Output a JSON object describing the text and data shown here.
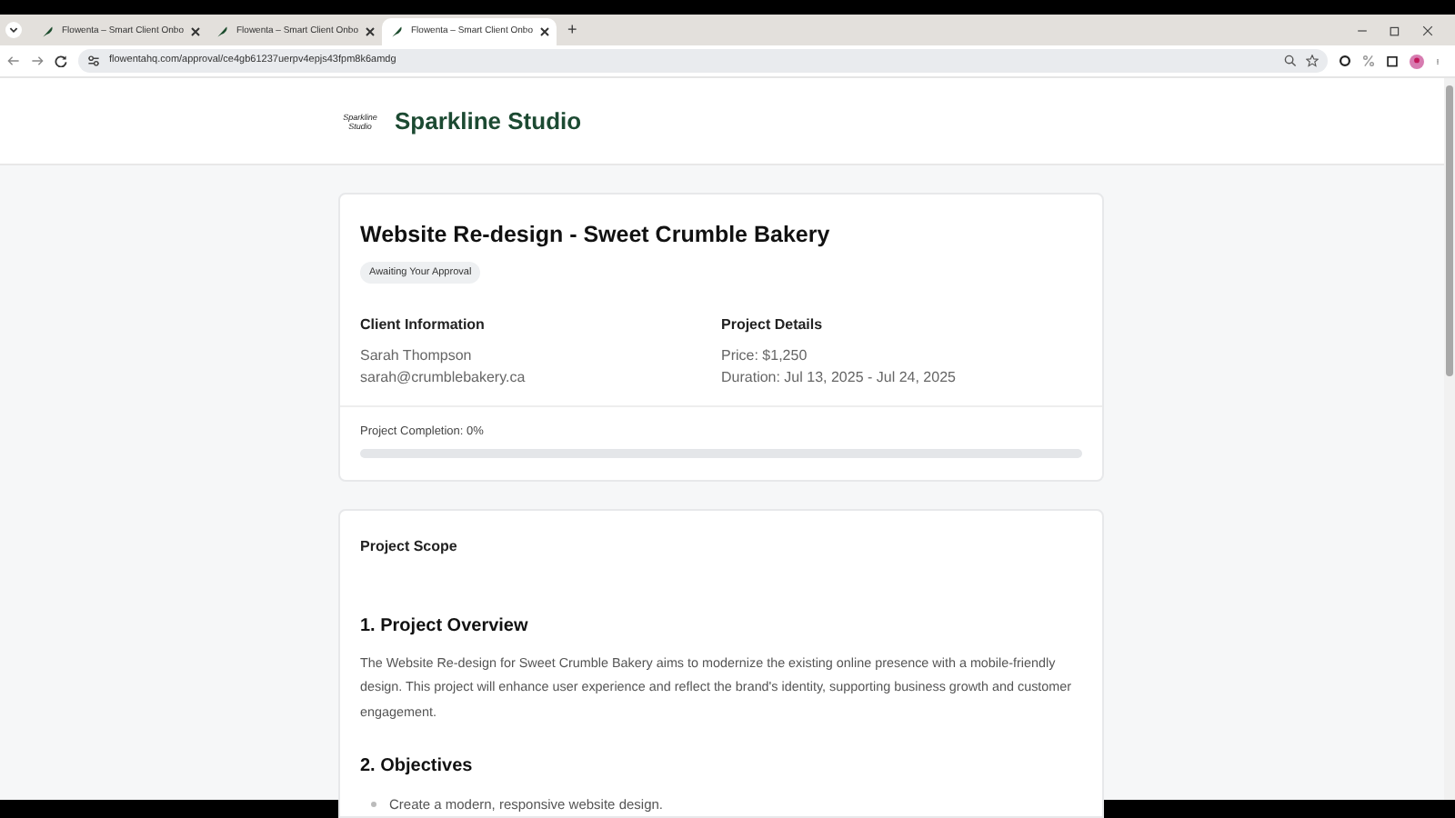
{
  "browser": {
    "tabs": [
      {
        "title": "Flowenta – Smart Client Onbo",
        "selected": false
      },
      {
        "title": "Flowenta – Smart Client Onbo",
        "selected": false
      },
      {
        "title": "Flowenta – Smart Client Onbo",
        "selected": true
      }
    ],
    "new_tab": "+",
    "url": "flowentahq.com/approval/ce4gb61237uerpv4epjs43fpm8k6amdg"
  },
  "header": {
    "logo_text": "Sparkline Studio",
    "brand": "Sparkline Studio"
  },
  "project": {
    "title": "Website Re-design - Sweet Crumble Bakery",
    "status": "Awaiting Your Approval",
    "client": {
      "heading": "Client Information",
      "lines": [
        "Sarah Thompson",
        "sarah@crumblebakery.ca"
      ]
    },
    "details": {
      "heading": "Project Details",
      "lines": [
        "Price: $1,250",
        "Duration: Jul 13, 2025 - Jul 24, 2025"
      ]
    },
    "completion": {
      "label": "Project Completion: 0%",
      "level": 0
    }
  },
  "scope": {
    "heading": "Project Scope",
    "sections": [
      {
        "title": "1. Project Overview",
        "paragraph": "The Website Re-design for Sweet Crumble Bakery aims to modernize the existing online presence with a mobile-friendly design. This project will enhance user experience and reflect the brand's identity, supporting business growth and customer engagement."
      },
      {
        "title": "2. Objectives",
        "items": [
          "Create a modern, responsive website design."
        ]
      }
    ]
  }
}
